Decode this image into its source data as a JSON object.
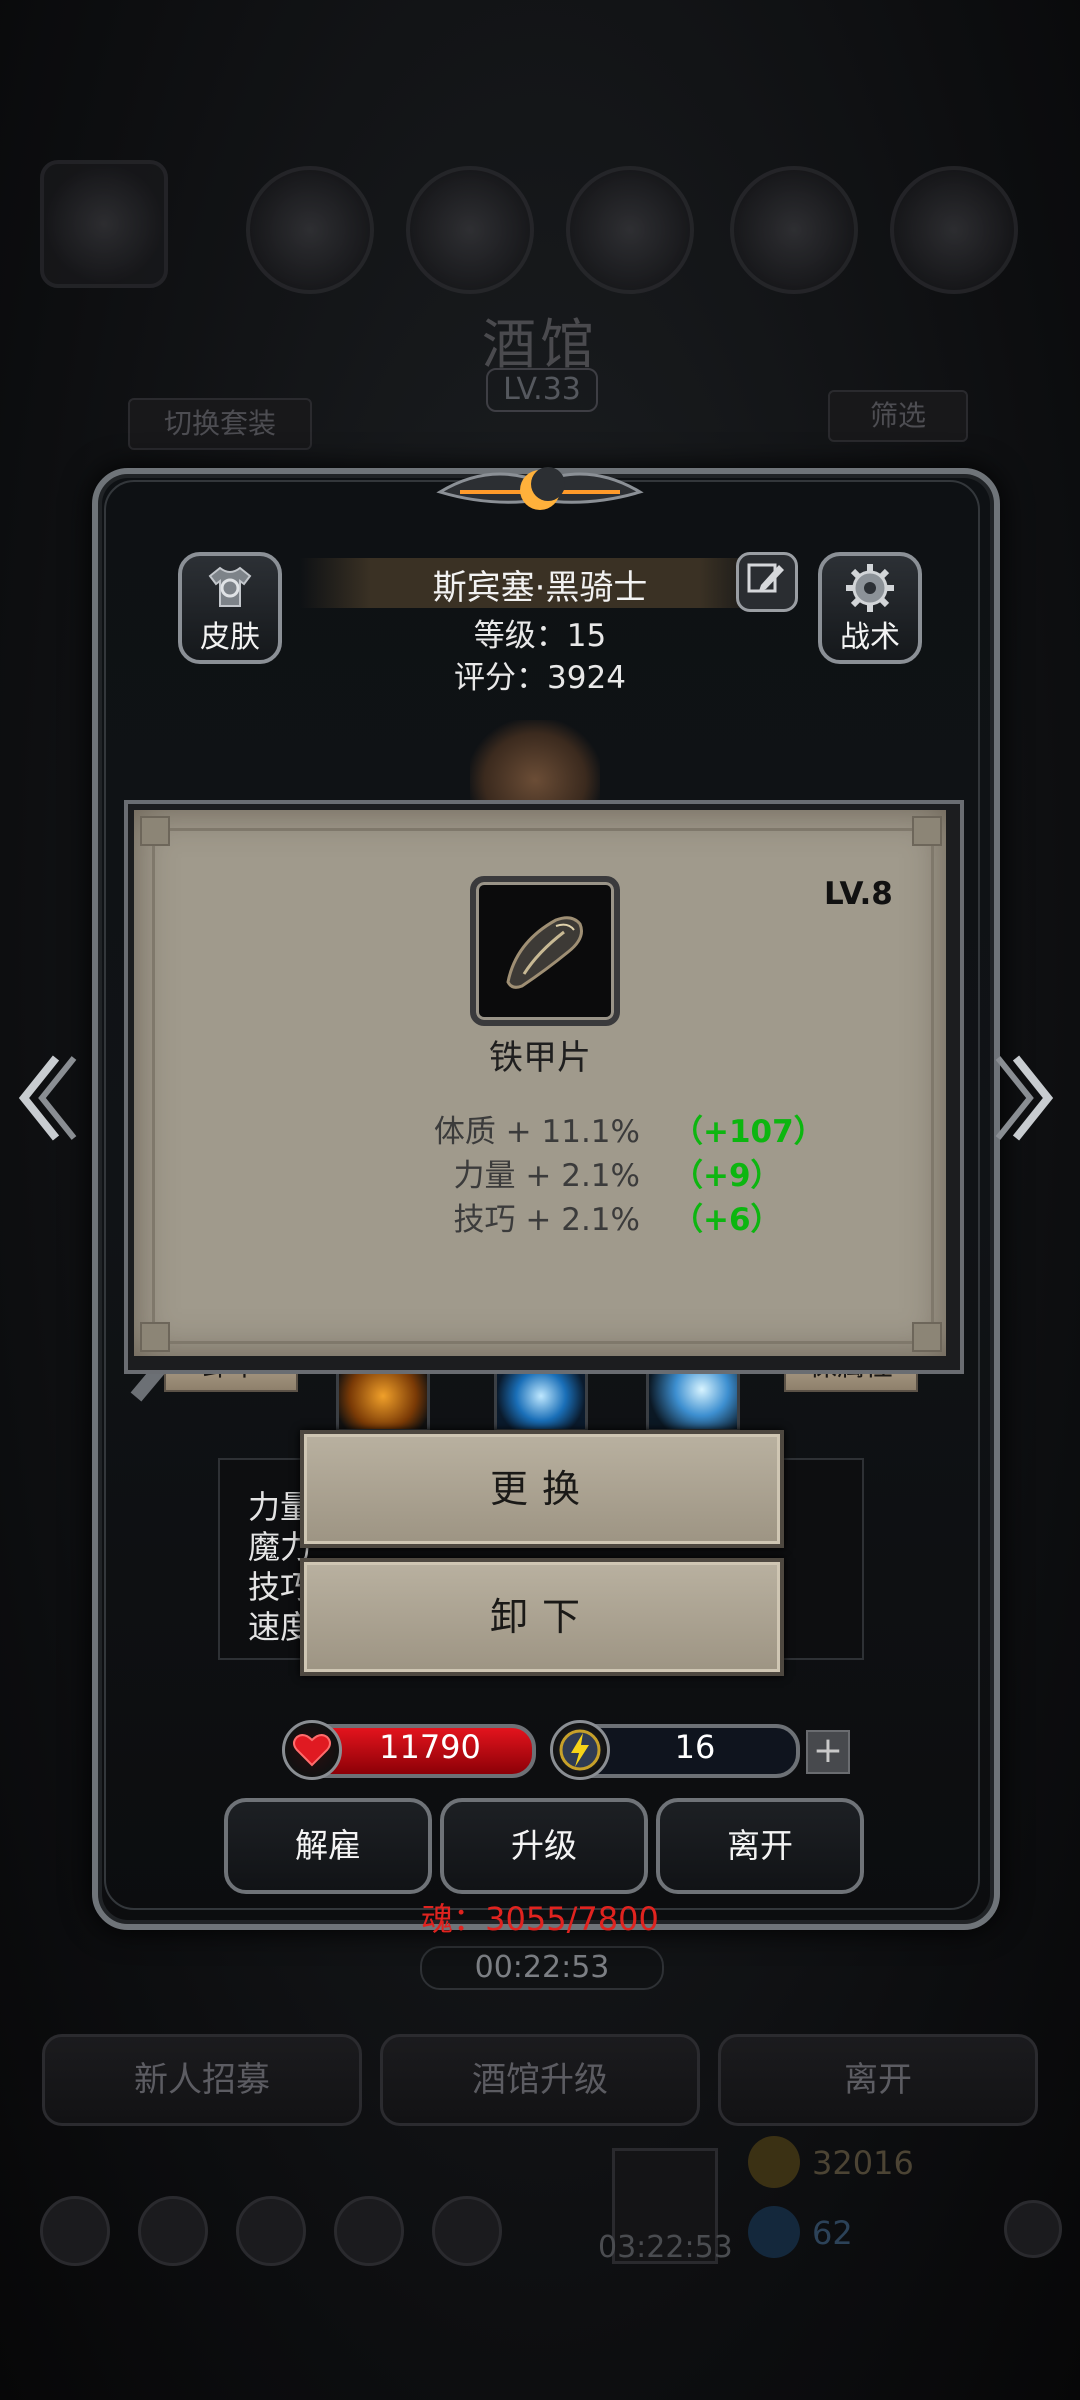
{
  "background": {
    "tavern_title": "酒馆",
    "tavern_level": "LV.33",
    "switch_outfit": "切换套装",
    "filter": "筛选",
    "bottom_timer": "00:22:53",
    "recruit": "新人招募",
    "upgrade_tavern": "酒馆升级",
    "leave": "离开",
    "gold": "32016",
    "gems": "62",
    "gift_timer": "03:22:53"
  },
  "hero": {
    "name": "斯宾塞·黑骑士",
    "level_text": "等级：15",
    "score_text": "评分：3924",
    "skin_button": "皮肤",
    "tactics_button": "战术",
    "unequip_tab": "卸下",
    "attr_tab": "保属性",
    "attr_labels": [
      "力量",
      "魔力",
      "技巧",
      "速度"
    ],
    "hp": "11790",
    "energy": "16",
    "energy_fill": 0.12,
    "plus": "+",
    "dismiss_button": "解雇",
    "upgrade_button": "升级",
    "leave_button": "离开",
    "soul_text": "魂：3055/7800"
  },
  "item_popup": {
    "level": "LV.8",
    "item_name": "铁甲片",
    "stats": [
      {
        "label": "体质 + 11.1%",
        "bonus": "（+107）"
      },
      {
        "label": "力量 + 2.1%",
        "bonus": "（+9）"
      },
      {
        "label": "技巧 + 2.1%",
        "bonus": "（+6）"
      }
    ],
    "replace_button": "更换",
    "unequip_button": "卸下"
  },
  "colors": {
    "bonus_green": "#0cb610",
    "soul_red": "#e0231f",
    "hp_red": "#e3141d",
    "energy_yellow": "#f2d21a",
    "popup_parchment": "#a09a8c"
  }
}
